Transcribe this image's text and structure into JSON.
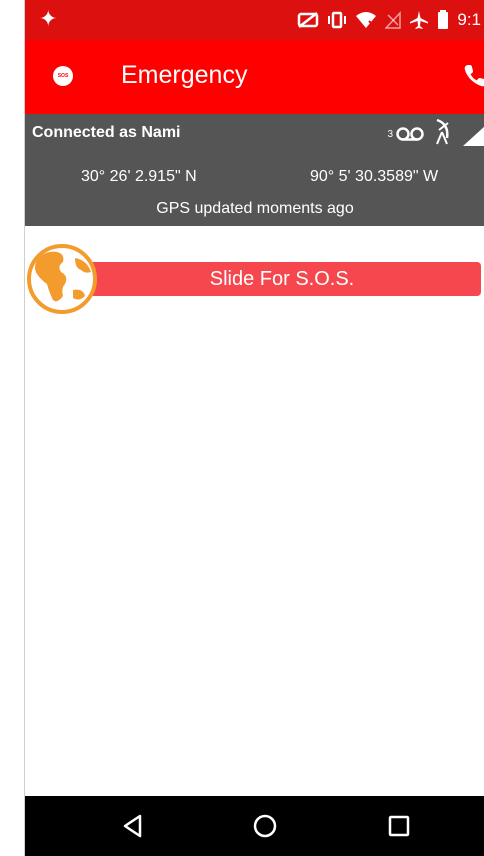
{
  "status_bar": {
    "time": "9:1",
    "icons": [
      "sparkle-icon",
      "no-sync-icon",
      "vibrate-icon",
      "wifi-off-icon",
      "no-signal-icon",
      "airplane-icon",
      "battery-icon"
    ]
  },
  "app_bar": {
    "badge": "SOS",
    "title": "Emergency"
  },
  "info_panel": {
    "connected": "Connected as Nami",
    "voicemail_count": "3",
    "latitude": "30° 26' 2.915\" N",
    "longitude": "90° 5' 30.3589\" W",
    "gps_status": "GPS updated moments ago"
  },
  "sos": {
    "slider_label": "Slide For S.O.S."
  },
  "colors": {
    "status_bar": "#dd1010",
    "app_bar": "#ff0000",
    "info_panel": "#555555",
    "slider": "#f5474d",
    "globe": "#f39c2d",
    "nav_bar": "#000000"
  }
}
